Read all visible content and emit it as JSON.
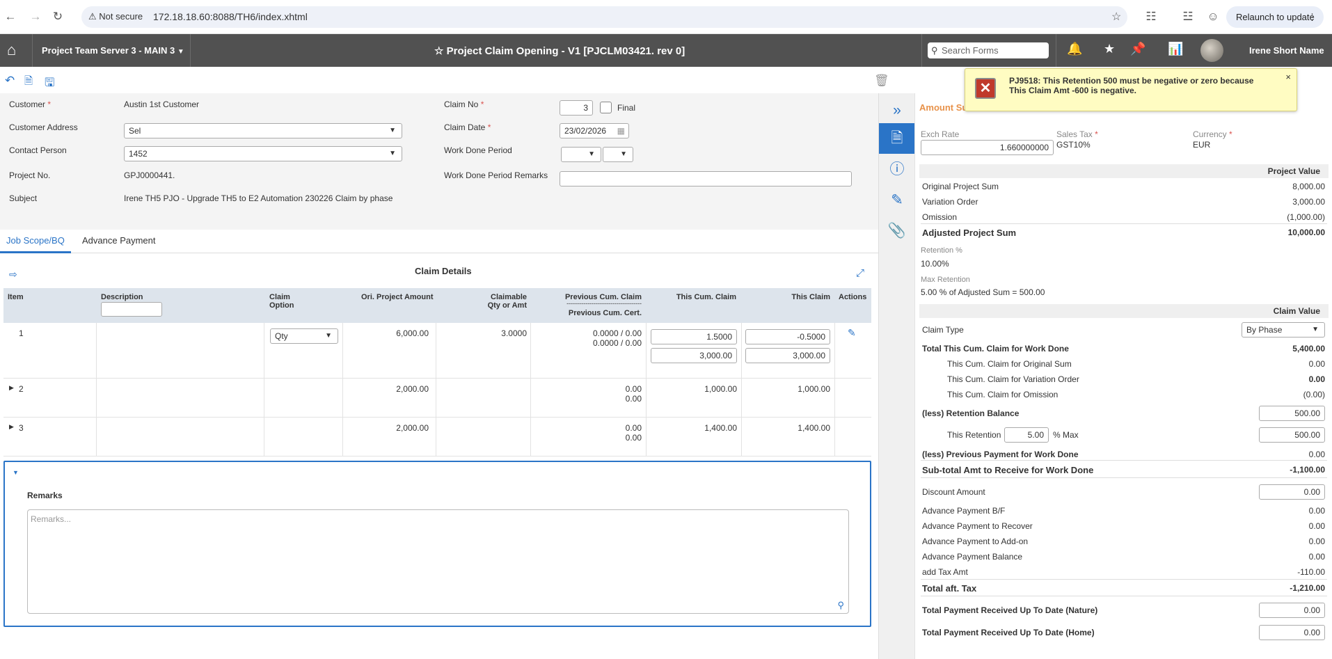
{
  "browser": {
    "security_label": "Not secure",
    "url": "172.18.18.60:8088/TH6/index.xhtml",
    "relaunch_label": "Relaunch to update"
  },
  "header": {
    "server": "Project Team Server 3 - MAIN 3",
    "title": "Project Claim Opening - V1 [PJCLM03421. rev 0]",
    "search_placeholder": "Search Forms",
    "user_name": "Irene Short Name"
  },
  "form": {
    "customer_label": "Customer",
    "customer_value": "Austin 1st Customer",
    "address_label": "Customer Address",
    "address_value": "Sel",
    "contact_label": "Contact Person",
    "contact_value": "1452",
    "project_no_label": "Project No.",
    "project_no_value": "GPJ0000441.",
    "subject_label": "Subject",
    "subject_value": "Irene TH5 PJO - Upgrade TH5 to E2 Automation 230226 Claim by phase",
    "claim_no_label": "Claim No",
    "claim_no_value": "3",
    "final_label": "Final",
    "claim_date_label": "Claim Date",
    "claim_date_value": "23/02/2026",
    "work_period_label": "Work Done Period",
    "work_period_remarks_label": "Work Done Period Remarks",
    "required_mark": "*"
  },
  "tabs": [
    "Job Scope/BQ",
    "Advance Payment"
  ],
  "grid": {
    "title": "Claim Details",
    "headers": {
      "item": "Item",
      "description": "Description",
      "claim_option_1": "Claim",
      "claim_option_2": "Option",
      "ori_amount": "Ori. Project Amount",
      "claimable_1": "Claimable",
      "claimable_2": "Qty or Amt",
      "prev_cum_claim": "Previous Cum. Claim",
      "prev_dashes": "------------------------------------",
      "prev_cum_cert": "Previous Cum. Cert.",
      "this_cum": "This Cum. Claim",
      "this_claim": "This Claim",
      "actions": "Actions"
    },
    "rows": [
      {
        "item": "1",
        "option": "Qty",
        "ori": "6,000.00",
        "claimable": "3.0000",
        "prev1": "0.0000 / 0.00",
        "prev2": "0.0000 / 0.00",
        "cum1": "1.5000",
        "cum2": "3,000.00",
        "claim1": "-0.5000",
        "claim2": "3,000.00"
      },
      {
        "item": "2",
        "ori": "2,000.00",
        "prev1": "0.00",
        "prev2": "0.00",
        "cum": "1,000.00",
        "claim": "1,000.00"
      },
      {
        "item": "3",
        "ori": "2,000.00",
        "prev1": "0.00",
        "prev2": "0.00",
        "cum": "1,400.00",
        "claim": "1,400.00"
      }
    ]
  },
  "remarks": {
    "label": "Remarks",
    "placeholder": "Remarks..."
  },
  "summary": {
    "title": "Amount Su",
    "exch_rate_label": "Exch Rate",
    "exch_rate_value": "1.660000000",
    "sales_tax_label": "Sales Tax",
    "sales_tax_value": "GST10%",
    "currency_label": "Currency",
    "currency_value": "EUR",
    "project_value_header": "Project Value",
    "original_sum_label": "Original Project Sum",
    "original_sum_value": "8,000.00",
    "variation_label": "Variation Order",
    "variation_value": "3,000.00",
    "omission_label": "Omission",
    "omission_value": "(1,000.00)",
    "adjusted_label": "Adjusted Project Sum",
    "adjusted_value": "10,000.00",
    "retention_pct_label": "Retention %",
    "retention_pct_value": "10.00%",
    "max_retention_label": "Max Retention",
    "max_retention_value": "5.00 % of Adjusted Sum = 500.00",
    "claim_value_header": "Claim Value",
    "claim_type_label": "Claim Type",
    "claim_type_value": "By Phase",
    "total_cum_label": "Total This Cum. Claim for Work Done",
    "total_cum_value": "5,400.00",
    "cum_original_label": "This Cum. Claim for Original Sum",
    "cum_original_value": "0.00",
    "cum_variation_label": "This Cum. Claim for Variation Order",
    "cum_variation_value": "0.00",
    "cum_omission_label": "This Cum. Claim for Omission",
    "cum_omission_value": "(0.00)",
    "retention_balance_label": "(less) Retention Balance",
    "retention_balance_value": "500.00",
    "this_retention_label": "This Retention",
    "this_retention_pct": "5.00",
    "max_label": "% Max",
    "this_retention_value": "500.00",
    "prev_payment_label": "(less) Previous Payment for Work Done",
    "prev_payment_value": "0.00",
    "subtotal_label": "Sub-total Amt to Receive for Work Done",
    "subtotal_value": "-1,100.00",
    "discount_label": "Discount Amount",
    "discount_value": "0.00",
    "adv_bf_label": "Advance Payment B/F",
    "adv_bf_value": "0.00",
    "adv_recover_label": "Advance Payment to Recover",
    "adv_recover_value": "0.00",
    "adv_addon_label": "Advance Payment to Add-on",
    "adv_addon_value": "0.00",
    "adv_balance_label": "Advance Payment Balance",
    "adv_balance_value": "0.00",
    "add_tax_label": "add Tax Amt",
    "add_tax_value": "-110.00",
    "total_aft_tax_label": "Total aft. Tax",
    "total_aft_tax_value": "-1,210.00",
    "received_nature_label": "Total Payment Received Up To Date (Nature)",
    "received_nature_value": "0.00",
    "received_home_label": "Total Payment Received Up To Date (Home)",
    "received_home_value": "0.00"
  },
  "toast": {
    "message": "PJ9518: This Retention 500 must be negative or zero because This Claim Amt -600 is negative.",
    "close": "×"
  },
  "colors": {
    "accent": "#2a74c7",
    "header_bg": "#515151",
    "toast_bg": "#fffcc2",
    "error": "#c0392b"
  }
}
